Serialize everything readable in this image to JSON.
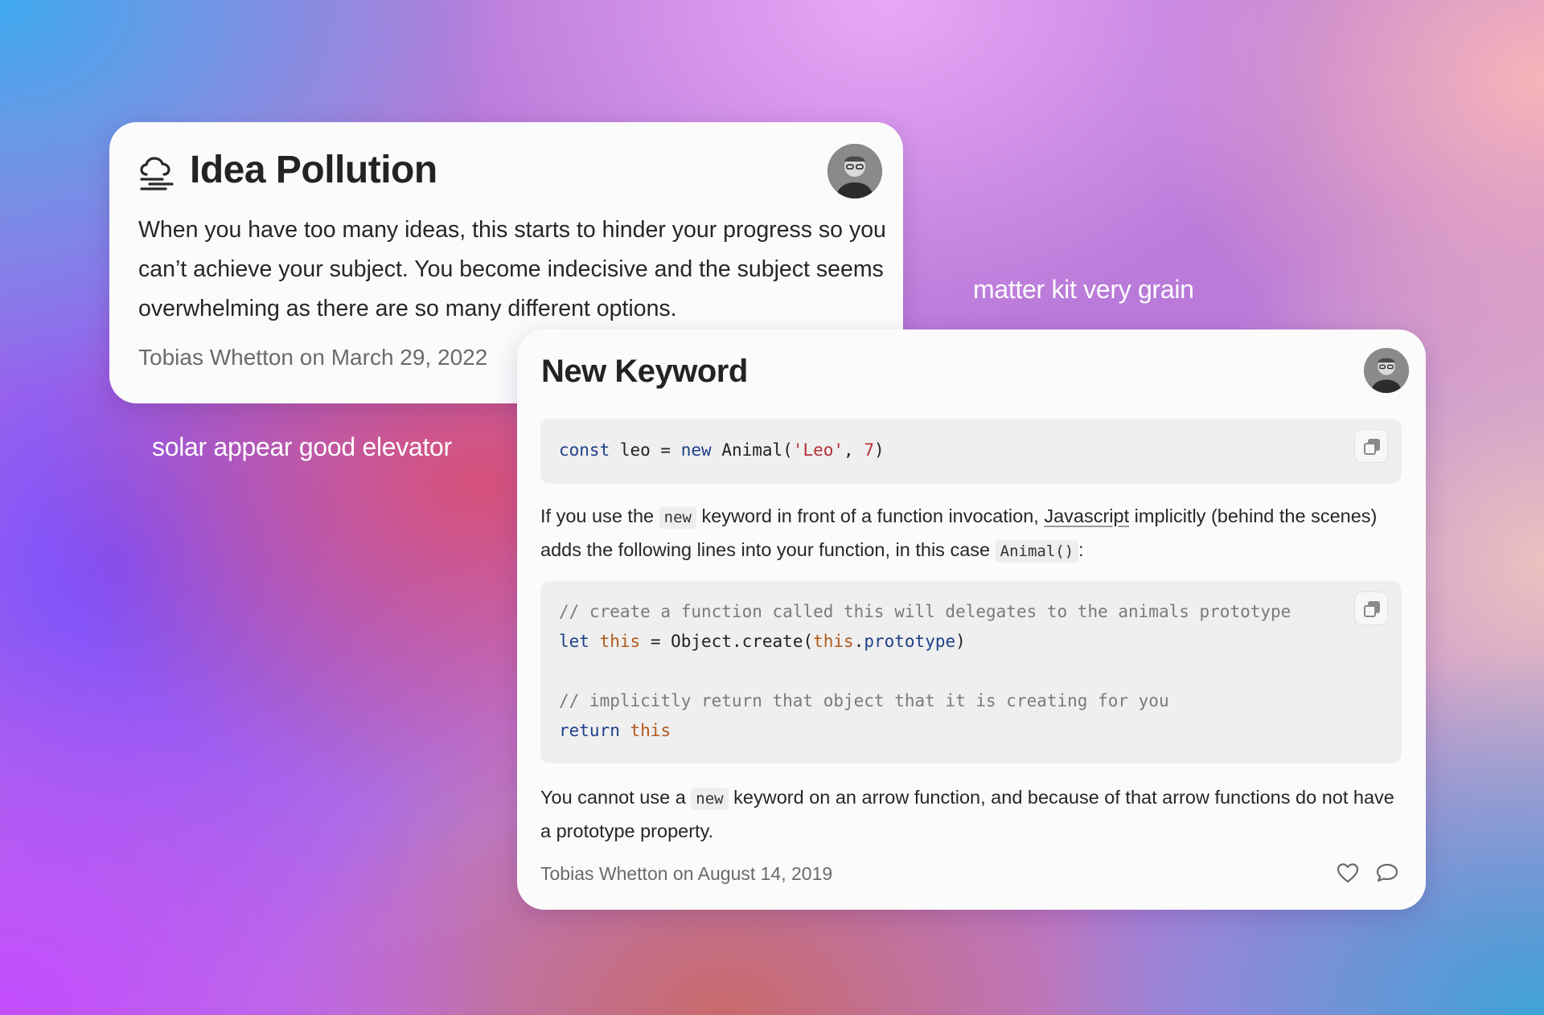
{
  "idea_card": {
    "title": "Idea Pollution",
    "body": "When you have too many ideas, this starts to hinder your progress so you can’t achieve your subject. You become indecisive and the subject seems overwhelming as there are so many different options.",
    "author": "Tobias Whetton",
    "date_prefix": "on",
    "date": "March 29, 2022",
    "icon": "fog-icon"
  },
  "keyword_card": {
    "title": "New Keyword",
    "code1": {
      "t1": "const",
      "t2": " leo = ",
      "t3": "new",
      "t4": " Animal(",
      "t5": "'Leo'",
      "t6": ", ",
      "t7": "7",
      "t8": ")"
    },
    "para1": {
      "a": "If you use the ",
      "code_new": "new",
      "b": " keyword in front of a function invocation, ",
      "link": "Javascript",
      "c": " implicitly (behind the scenes) adds the following lines into your function, in this case ",
      "code_animal": "Animal()",
      "d": ":"
    },
    "code2": {
      "line1": "// create a function called this will delegates to the animals prototype",
      "l2_kw": "let",
      "l2_a": " ",
      "l2_this": "this",
      "l2_b": " = Object.create(",
      "l2_this2": "this",
      "l2_c": ".",
      "l2_prop": "prototype",
      "l2_d": ")",
      "line4": "// implicitly return that object that it is creating for you",
      "l5_kw": "return",
      "l5_a": " ",
      "l5_this": "this"
    },
    "para2": {
      "a": "You cannot use a ",
      "code_new": "new",
      "b": " keyword on an arrow function, and because of that arrow functions do not have a prototype property."
    },
    "author": "Tobias Whetton",
    "date_prefix": "on",
    "date": "August 14, 2019",
    "icons": [
      "heart-icon",
      "comment-icon",
      "copy-icon"
    ]
  },
  "floating_labels": {
    "right": "matter kit very grain",
    "left": "solar appear good elevator"
  }
}
